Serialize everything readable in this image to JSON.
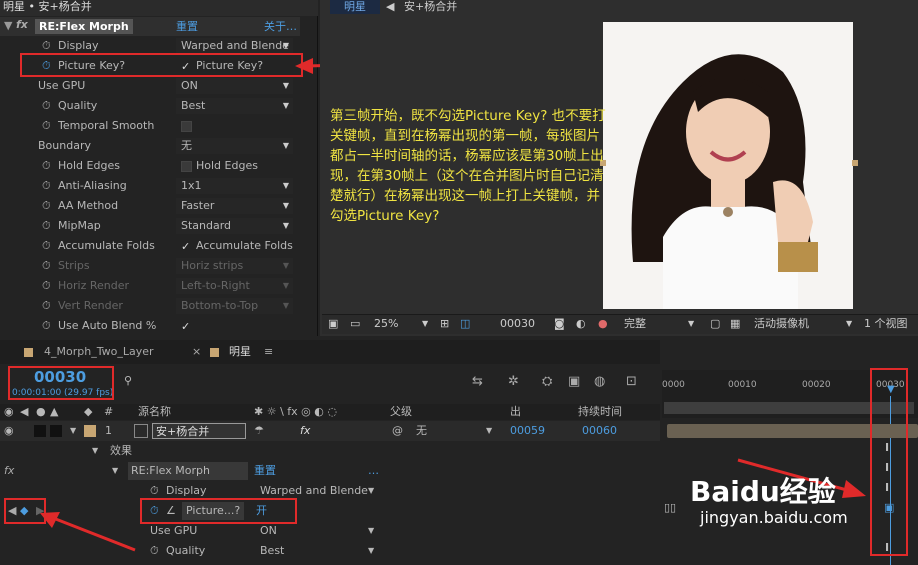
{
  "panel": {
    "header": "明星 • 安+杨合并",
    "effect_name": "RE:Flex Morph",
    "reset": "重置",
    "about": "关于…",
    "rows": [
      {
        "name": "Display",
        "value": "Warped and Blende"
      },
      {
        "name": "Picture Key?",
        "value": "Picture Key?"
      },
      {
        "name": "Use GPU",
        "value": "ON"
      },
      {
        "name": "Quality",
        "value": "Best"
      },
      {
        "name": "Temporal Smooth",
        "value": ""
      },
      {
        "name": "Boundary",
        "value": "无"
      },
      {
        "name": "Hold Edges",
        "value": "Hold Edges"
      },
      {
        "name": "Anti-Aliasing",
        "value": "1x1"
      },
      {
        "name": "AA Method",
        "value": "Faster"
      },
      {
        "name": "MipMap",
        "value": "Standard"
      },
      {
        "name": "Accumulate Folds",
        "value": "Accumulate Folds"
      },
      {
        "name": "Strips",
        "value": "Horiz strips"
      },
      {
        "name": "Horiz Render",
        "value": "Left-to-Right"
      },
      {
        "name": "Vert Render",
        "value": "Bottom-to-Top"
      },
      {
        "name": "Use Auto Blend %",
        "value": ""
      }
    ]
  },
  "viewer": {
    "tab": "明星",
    "breadcrumb": "安+杨合并",
    "note": "第三帧开始，既不勾选Picture Key? 也不要打关键帧，直到在杨幂出现的第一帧，每张图片都占一半时间轴的话，杨幂应该是第30帧上出现，在第30帧上（这个在合并图片时自己记清楚就行）在杨幂出现这一帧上打上关键帧，并勾选Picture Key?",
    "zoom": "25%",
    "timecode": "00030",
    "quality": "完整",
    "camera": "活动摄像机",
    "views": "1 个视图"
  },
  "timeline": {
    "tabs": [
      "4_Morph_Two_Layer",
      "明星"
    ],
    "timecode": "00030",
    "timecode_sub": "0:00:01:00 (29.97 fps)",
    "col_source": "源名称",
    "col_parent": "父级",
    "col_out": "出",
    "col_duration": "持续时间",
    "layer_index": "1",
    "layer_name": "安+杨合并",
    "parent_value": "无",
    "out": "00059",
    "duration": "00060",
    "effects_label": "效果",
    "effect_name": "RE:Flex Morph",
    "reset": "重置",
    "display_label": "Display",
    "display_value": "Warped and Blende",
    "picture_label": "Picture...?",
    "picture_value": "开",
    "usegpu_label": "Use GPU",
    "usegpu_value": "ON",
    "quality_label": "Quality",
    "quality_value": "Best",
    "ruler": [
      "0000",
      "00010",
      "00020",
      "00030"
    ]
  },
  "watermark": {
    "text": "Baidu经验",
    "url": "jingyan.baidu.com"
  }
}
